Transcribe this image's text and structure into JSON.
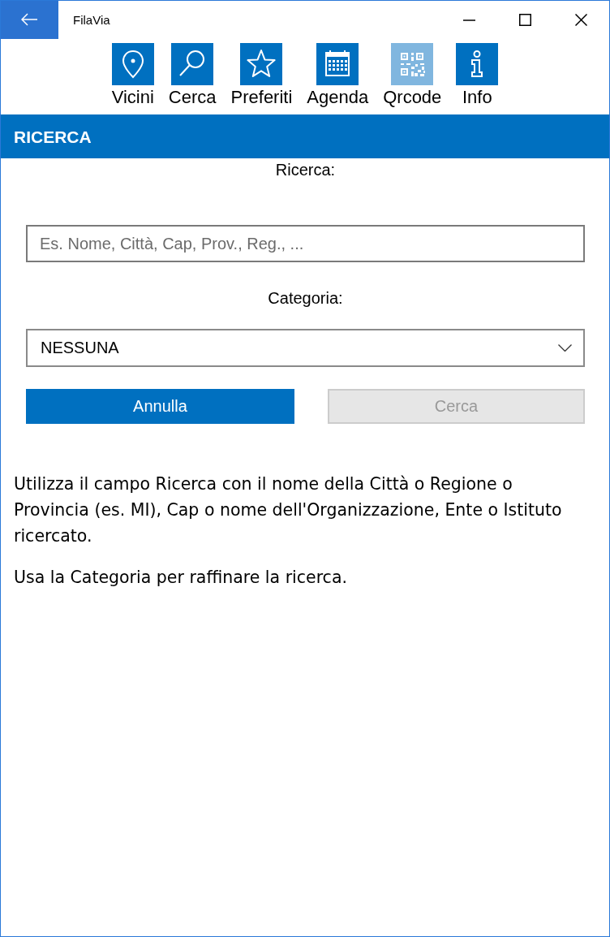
{
  "window": {
    "title": "FilaVia"
  },
  "toolbar": {
    "items": [
      {
        "label": "Vicini",
        "kind": "pin",
        "disabled": false
      },
      {
        "label": "Cerca",
        "kind": "search",
        "disabled": false
      },
      {
        "label": "Preferiti",
        "kind": "star",
        "disabled": false
      },
      {
        "label": "Agenda",
        "kind": "calendar",
        "disabled": false
      },
      {
        "label": "Qrcode",
        "kind": "qrcode",
        "disabled": true
      },
      {
        "label": "Info",
        "kind": "info",
        "disabled": false
      }
    ]
  },
  "section_header": {
    "title": "RICERCA"
  },
  "form": {
    "search_label": "Ricerca:",
    "search_field": {
      "placeholder": "Es. Nome, Città, Cap, Prov., Reg., ..."
    },
    "category_label": "Categoria:",
    "category_select": {
      "value": "NESSUNA"
    },
    "buttons": [
      {
        "label": "Annulla",
        "disabled": false
      },
      {
        "label": "Cerca",
        "disabled": true
      }
    ]
  },
  "help": {
    "paragraphs": [
      "Utilizza il campo Ricerca con il nome della Città o Regione o Provincia (es. MI), Cap o nome dell'Organizzazione, Ente o Istituto ricercato.",
      "Usa la Categoria per raffinare la ricerca."
    ]
  }
}
